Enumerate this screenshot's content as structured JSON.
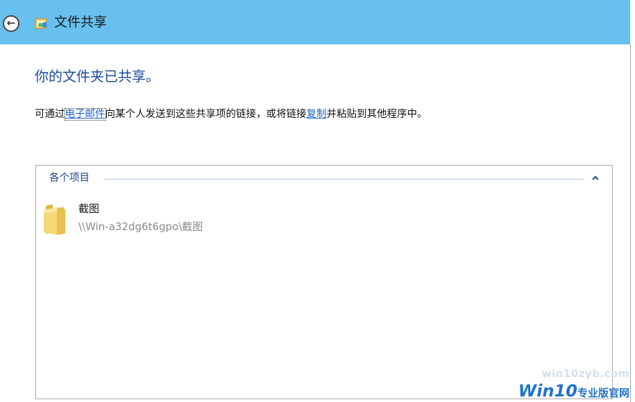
{
  "window": {
    "title": "文件共享",
    "app_icon": "sharing-wizard-icon",
    "back_icon": "back-arrow-icon",
    "accent_color": "#68c0ee"
  },
  "content": {
    "heading": "你的文件夹已共享。",
    "description": {
      "prefix": "可通过",
      "email_link": "电子邮件",
      "middle": "向某个人发送到这些共享项的链接，或将链接",
      "copy_link": "复制",
      "suffix": "并粘贴到其他程序中。"
    }
  },
  "items_panel": {
    "group_title": "各个项目",
    "collapse_icon": "chevron-up-icon",
    "items": [
      {
        "name": "截图",
        "path": "\\\\Win-a32dg6t6gpo\\截图",
        "icon": "folder-icon"
      }
    ]
  },
  "watermark": {
    "url": "win10zyb.com",
    "brand_latin": "Win10",
    "brand_cn": "专业版官网"
  }
}
